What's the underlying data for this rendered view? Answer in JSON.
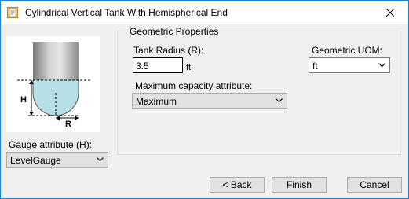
{
  "window": {
    "title": "Cylindrical Vertical Tank With Hemispherical End"
  },
  "diagram": {
    "h_label": "H",
    "r_label": "R"
  },
  "gauge": {
    "label": "Gauge attribute (H):",
    "value": "LevelGauge"
  },
  "geometric": {
    "group_title": "Geometric Properties",
    "radius_label": "Tank Radius (R):",
    "radius_value": "3.5",
    "radius_unit": "ft",
    "uom_label": "Geometric UOM:",
    "uom_value": "ft",
    "max_cap_label": "Maximum capacity attribute:",
    "max_cap_value": "Maximum"
  },
  "buttons": {
    "back": "< Back",
    "finish": "Finish",
    "cancel": "Cancel"
  },
  "colors": {
    "liquid": "#b7e0e6",
    "window_border": "#1883d7",
    "dialog_bg": "#f0f0f0"
  }
}
